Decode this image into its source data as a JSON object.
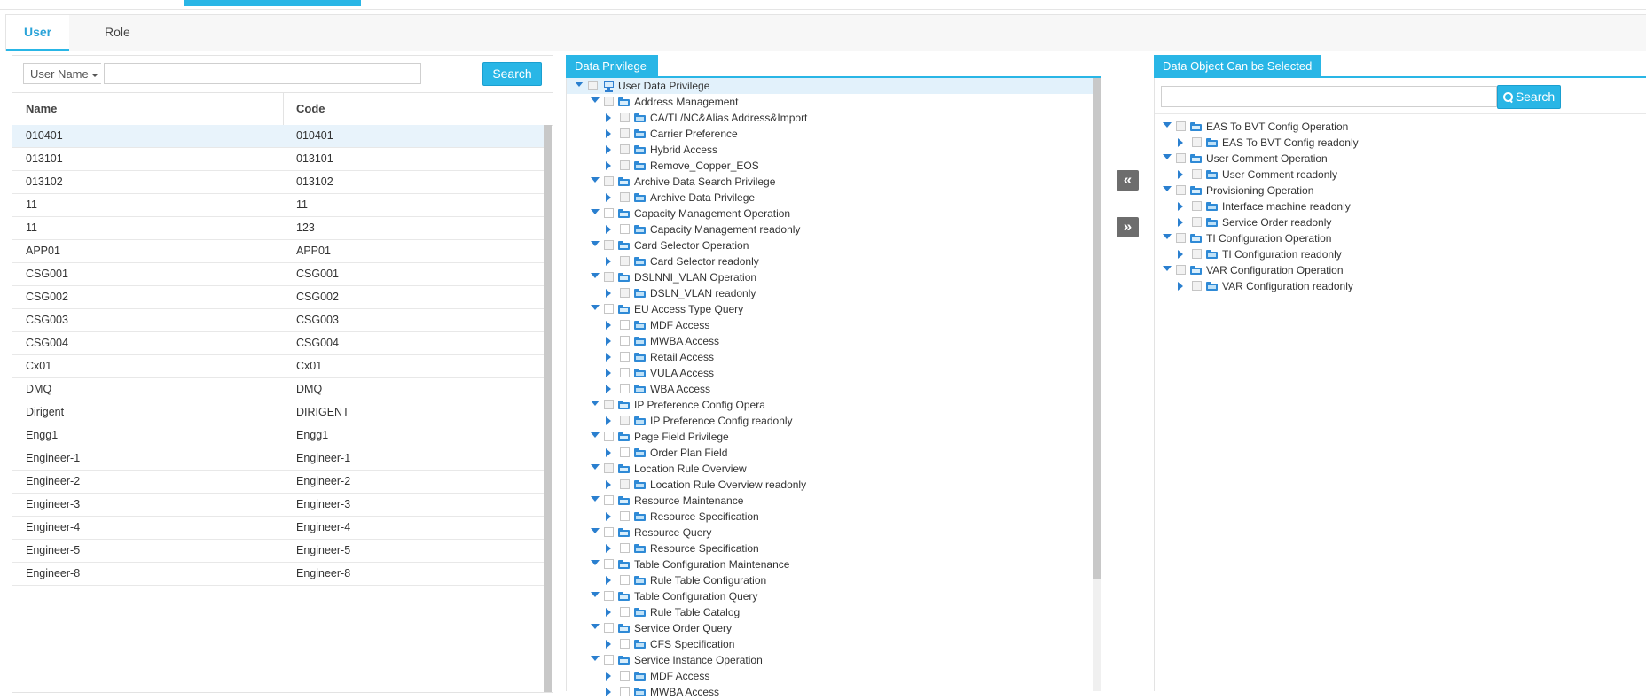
{
  "tabs": [
    {
      "label": "User"
    },
    {
      "label": "Role"
    }
  ],
  "user_search": {
    "field_label": "User Name",
    "button": "Search"
  },
  "user_grid": {
    "columns": [
      "Name",
      "Code"
    ],
    "rows": [
      [
        "010401",
        "010401"
      ],
      [
        "013101",
        "013101"
      ],
      [
        "013102",
        "013102"
      ],
      [
        "11",
        "11"
      ],
      [
        "11",
        "123"
      ],
      [
        "APP01",
        "APP01"
      ],
      [
        "CSG001",
        "CSG001"
      ],
      [
        "CSG002",
        "CSG002"
      ],
      [
        "CSG003",
        "CSG003"
      ],
      [
        "CSG004",
        "CSG004"
      ],
      [
        "Cx01",
        "Cx01"
      ],
      [
        "DMQ",
        "DMQ"
      ],
      [
        "Dirigent",
        "DIRIGENT"
      ],
      [
        "Engg1",
        "Engg1"
      ],
      [
        "Engineer-1",
        "Engineer-1"
      ],
      [
        "Engineer-2",
        "Engineer-2"
      ],
      [
        "Engineer-3",
        "Engineer-3"
      ],
      [
        "Engineer-4",
        "Engineer-4"
      ],
      [
        "Engineer-5",
        "Engineer-5"
      ],
      [
        "Engineer-8",
        "Engineer-8"
      ]
    ]
  },
  "data_privilege": {
    "title": "Data Privilege",
    "root": "User Data Privilege",
    "groups": [
      {
        "label": "Address Management",
        "children": [
          "CA/TL/NC&Alias Address&Import",
          "Carrier Preference",
          "Hybrid Access",
          "Remove_Copper_EOS"
        ]
      },
      {
        "label": "Archive Data Search Privilege",
        "children": [
          "Archive Data Privilege"
        ]
      },
      {
        "label": "Capacity Management Operation",
        "children": [
          "Capacity Management readonly"
        ]
      },
      {
        "label": "Card Selector Operation",
        "children": [
          "Card Selector readonly"
        ]
      },
      {
        "label": "DSLNNI_VLAN Operation",
        "children": [
          "DSLN_VLAN readonly"
        ]
      },
      {
        "label": "EU Access Type Query",
        "children": [
          "MDF Access",
          "MWBA Access",
          "Retail Access",
          "VULA Access",
          "WBA Access"
        ]
      },
      {
        "label": "IP Preference Config Opera",
        "children": [
          "IP Preference Config readonly"
        ]
      },
      {
        "label": "Page Field Privilege",
        "children": [
          "Order Plan Field"
        ]
      },
      {
        "label": "Location Rule Overview",
        "children": [
          "Location Rule Overview readonly"
        ]
      },
      {
        "label": "Resource Maintenance",
        "children": [
          "Resource Specification"
        ]
      },
      {
        "label": "Resource Query",
        "children": [
          "Resource Specification"
        ]
      },
      {
        "label": "Table Configuration Maintenance",
        "children": [
          "Rule Table Configuration"
        ]
      },
      {
        "label": "Table Configuration Query",
        "children": [
          "Rule Table Catalog"
        ]
      },
      {
        "label": "Service Order Query",
        "children": [
          "CFS Specification"
        ]
      },
      {
        "label": "Service Instance Operation",
        "children": [
          "MDF Access",
          "MWBA Access"
        ]
      }
    ]
  },
  "transfer": {
    "left": "«",
    "right": "»"
  },
  "selectable": {
    "title": "Data Object Can be Selected",
    "button": "Search",
    "groups": [
      {
        "label": "EAS To BVT Config Operation",
        "children": [
          "EAS To BVT Config readonly"
        ]
      },
      {
        "label": "User Comment Operation",
        "children": [
          "User Comment readonly"
        ]
      },
      {
        "label": "Provisioning Operation",
        "children": [
          "Interface machine readonly",
          "Service Order readonly"
        ]
      },
      {
        "label": "TI Configuration Operation",
        "children": [
          "TI Configuration readonly"
        ]
      },
      {
        "label": "VAR Configuration Operation",
        "children": [
          "VAR Configuration readonly"
        ]
      }
    ]
  }
}
